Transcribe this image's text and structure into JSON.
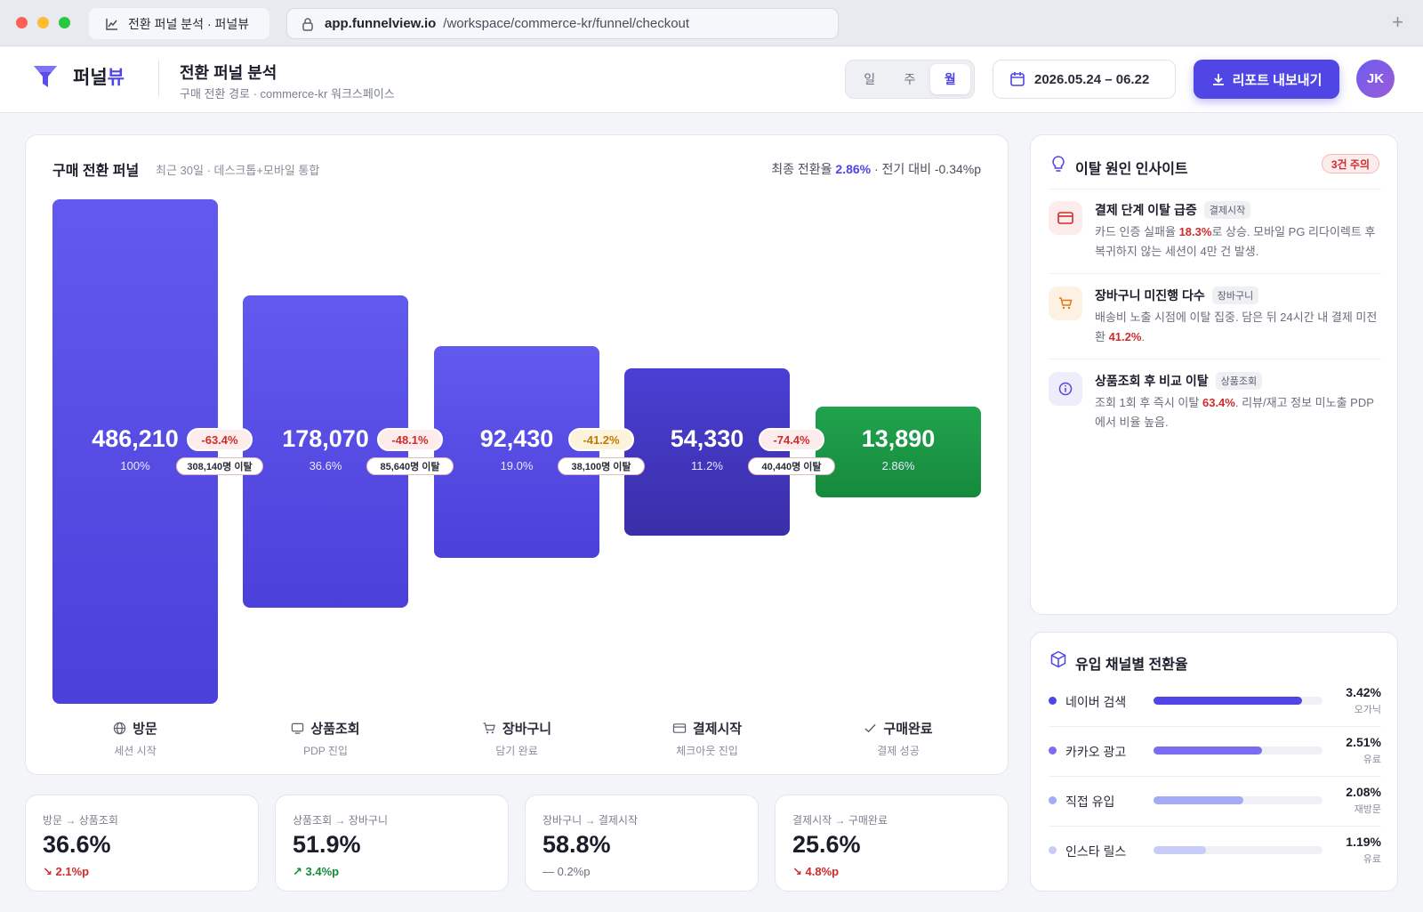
{
  "browser": {
    "tab_title": "전환 퍼널 분석 · 퍼널뷰",
    "url_host": "app.funnelview.io",
    "url_path": "/workspace/commerce-kr/funnel/checkout",
    "new_tab": "+"
  },
  "app": {
    "logo_main": "퍼널",
    "logo_accent": "뷰",
    "page_title": "전환 퍼널 분석",
    "page_subtitle": "구매 전환 경로 · commerce-kr 워크스페이스",
    "period_options": [
      "일",
      "주",
      "월"
    ],
    "period_selected": "월",
    "date_range": "2026.05.24 – 06.22",
    "export_label": "리포트 내보내기",
    "avatar_initials": "JK"
  },
  "funnel": {
    "title": "구매 전환 퍼널",
    "subtitle": "최근 30일 · 데스크톱+모바일 통합",
    "final_rate_label": "최종 전환율",
    "final_rate": "2.86%",
    "compare": "· 전기 대비 -0.34%p",
    "stages": [
      {
        "name": "방문",
        "desc": "세션 시작",
        "value": "486,210",
        "pct": "100%",
        "icon": "globe-icon"
      },
      {
        "name": "상품조회",
        "desc": "PDP 진입",
        "value": "178,070",
        "pct": "36.6%",
        "icon": "card-icon"
      },
      {
        "name": "장바구니",
        "desc": "담기 완료",
        "value": "92,430",
        "pct": "19.0%",
        "icon": "cart-icon"
      },
      {
        "name": "결제시작",
        "desc": "체크아웃 진입",
        "value": "54,330",
        "pct": "11.2%",
        "icon": "credit-card-icon"
      },
      {
        "name": "구매완료",
        "desc": "결제 성공",
        "value": "13,890",
        "pct": "2.86%",
        "icon": "check-icon"
      }
    ],
    "drops": [
      {
        "rate": "-63.4%",
        "lost": "308,140명 이탈"
      },
      {
        "rate": "-48.1%",
        "lost": "85,640명 이탈"
      },
      {
        "rate": "-41.2%",
        "lost": "38,100명 이탈"
      },
      {
        "rate": "-74.4%",
        "lost": "40,440명 이탈"
      }
    ]
  },
  "kpis": [
    {
      "label": "방문 → 상품조회",
      "value": "36.6%",
      "delta": "↘ 2.1%p",
      "trend": "down"
    },
    {
      "label": "상품조회 → 장바구니",
      "value": "51.9%",
      "delta": "↗ 3.4%p",
      "trend": "up"
    },
    {
      "label": "장바구니 → 결제시작",
      "value": "58.8%",
      "delta": "— 0.2%p",
      "trend": "flat"
    },
    {
      "label": "결제시작 → 구매완료",
      "value": "25.6%",
      "delta": "↘ 4.8%p",
      "trend": "down"
    }
  ],
  "insights": {
    "title": "이탈 원인 인사이트",
    "badge": "3건 주의",
    "items": [
      {
        "title": "결제 단계 이탈 급증",
        "tag": "결제시작",
        "text_a": "카드 인증 실패율 ",
        "hl": "18.3%",
        "text_b": "로 상승. 모바일 PG 리다이렉트 후 복귀하지 않는 세션이 4만 건 발생.",
        "icon": "credit-card-icon"
      },
      {
        "title": "장바구니 미진행 다수",
        "tag": "장바구니",
        "text_a": "배송비 노출 시점에 이탈 집중. 담은 뒤 24시간 내 결제 미전환 ",
        "hl": "41.2%",
        "text_b": ".",
        "icon": "cart-icon"
      },
      {
        "title": "상품조회 후 비교 이탈",
        "tag": "상품조회",
        "text_a": "조회 1회 후 즉시 이탈 ",
        "hl": "63.4%",
        "text_b": ". 리뷰/재고 정보 미노출 PDP에서 비율 높음.",
        "icon": "info-icon"
      }
    ]
  },
  "channels": {
    "title": "유입 채널별 전환율",
    "items": [
      {
        "name": "네이버 검색",
        "rate": "3.42%",
        "type": "오가닉",
        "value": 0.88,
        "color": "#4f46e5"
      },
      {
        "name": "카카오 광고",
        "rate": "2.51%",
        "type": "유료",
        "value": 0.64,
        "color": "#7b6cf0"
      },
      {
        "name": "직접 유입",
        "rate": "2.08%",
        "type": "재방문",
        "value": 0.53,
        "color": "#a2abf3"
      },
      {
        "name": "인스타 릴스",
        "rate": "1.19%",
        "type": "유료",
        "value": 0.31,
        "color": "#c8cdf7"
      }
    ]
  },
  "colors": {
    "accent": "#4f46e5",
    "success": "#158a3b",
    "danger": "#d12b2b",
    "warning": "#c07a05"
  }
}
